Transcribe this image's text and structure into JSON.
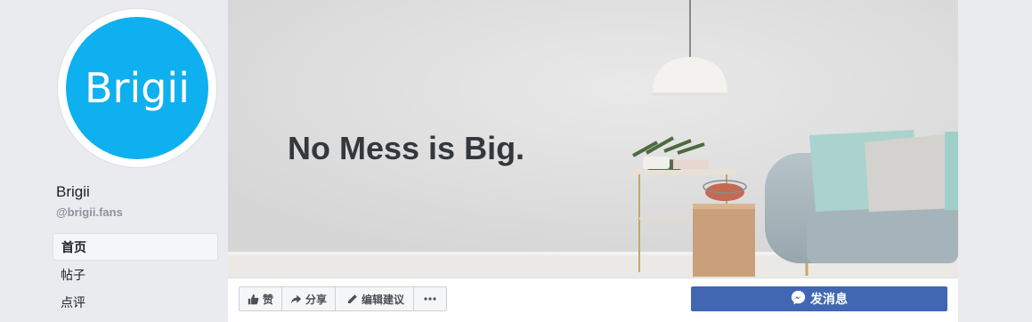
{
  "profile": {
    "logo_text": "Brigii",
    "name": "Brigii",
    "handle": "@brigii.fans",
    "brand_color": "#0fb0ef"
  },
  "nav": {
    "items": [
      {
        "label": "首页",
        "active": true
      },
      {
        "label": "帖子",
        "active": false
      },
      {
        "label": "点评",
        "active": false
      }
    ]
  },
  "cover": {
    "headline": "No Mess is Big."
  },
  "actions": {
    "like_label": "赞",
    "like_icon": "thumbs-up-icon",
    "share_label": "分享",
    "share_icon": "share-arrow-icon",
    "suggest_label": "编辑建议",
    "suggest_icon": "pencil-icon",
    "more_icon": "more-dots-icon",
    "message_label": "发消息",
    "message_icon": "messenger-icon",
    "message_color": "#4267b2"
  }
}
